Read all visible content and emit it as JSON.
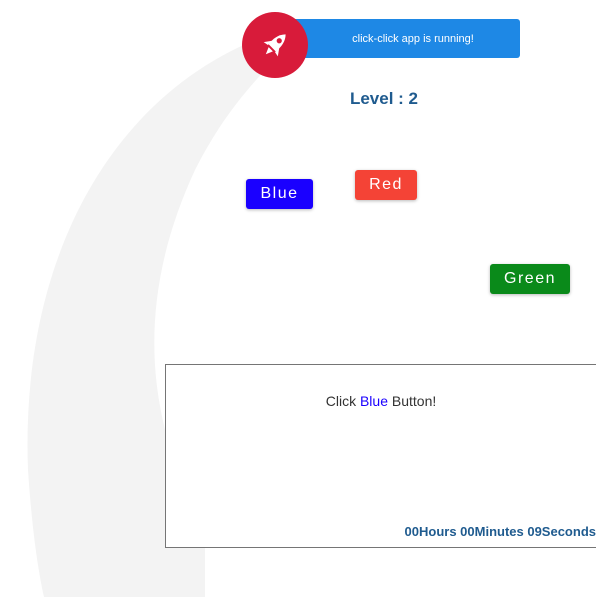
{
  "banner": {
    "message": "click-click app is running!",
    "icon": "rocket-icon",
    "bg_color": "#1e88e5",
    "badge_color": "#d81b3a"
  },
  "level": {
    "text": "Level : 2"
  },
  "buttons": {
    "blue": {
      "label": "Blue",
      "color": "#1a00ff"
    },
    "red": {
      "label": "Red",
      "color": "#f44336"
    },
    "green": {
      "label": "Green",
      "color": "#0a8a1a"
    }
  },
  "panel": {
    "instruction_prefix": "Click",
    "instruction_color": "Blue",
    "instruction_suffix": "Button!",
    "timer": "00Hours 00Minutes 09Seconds"
  }
}
